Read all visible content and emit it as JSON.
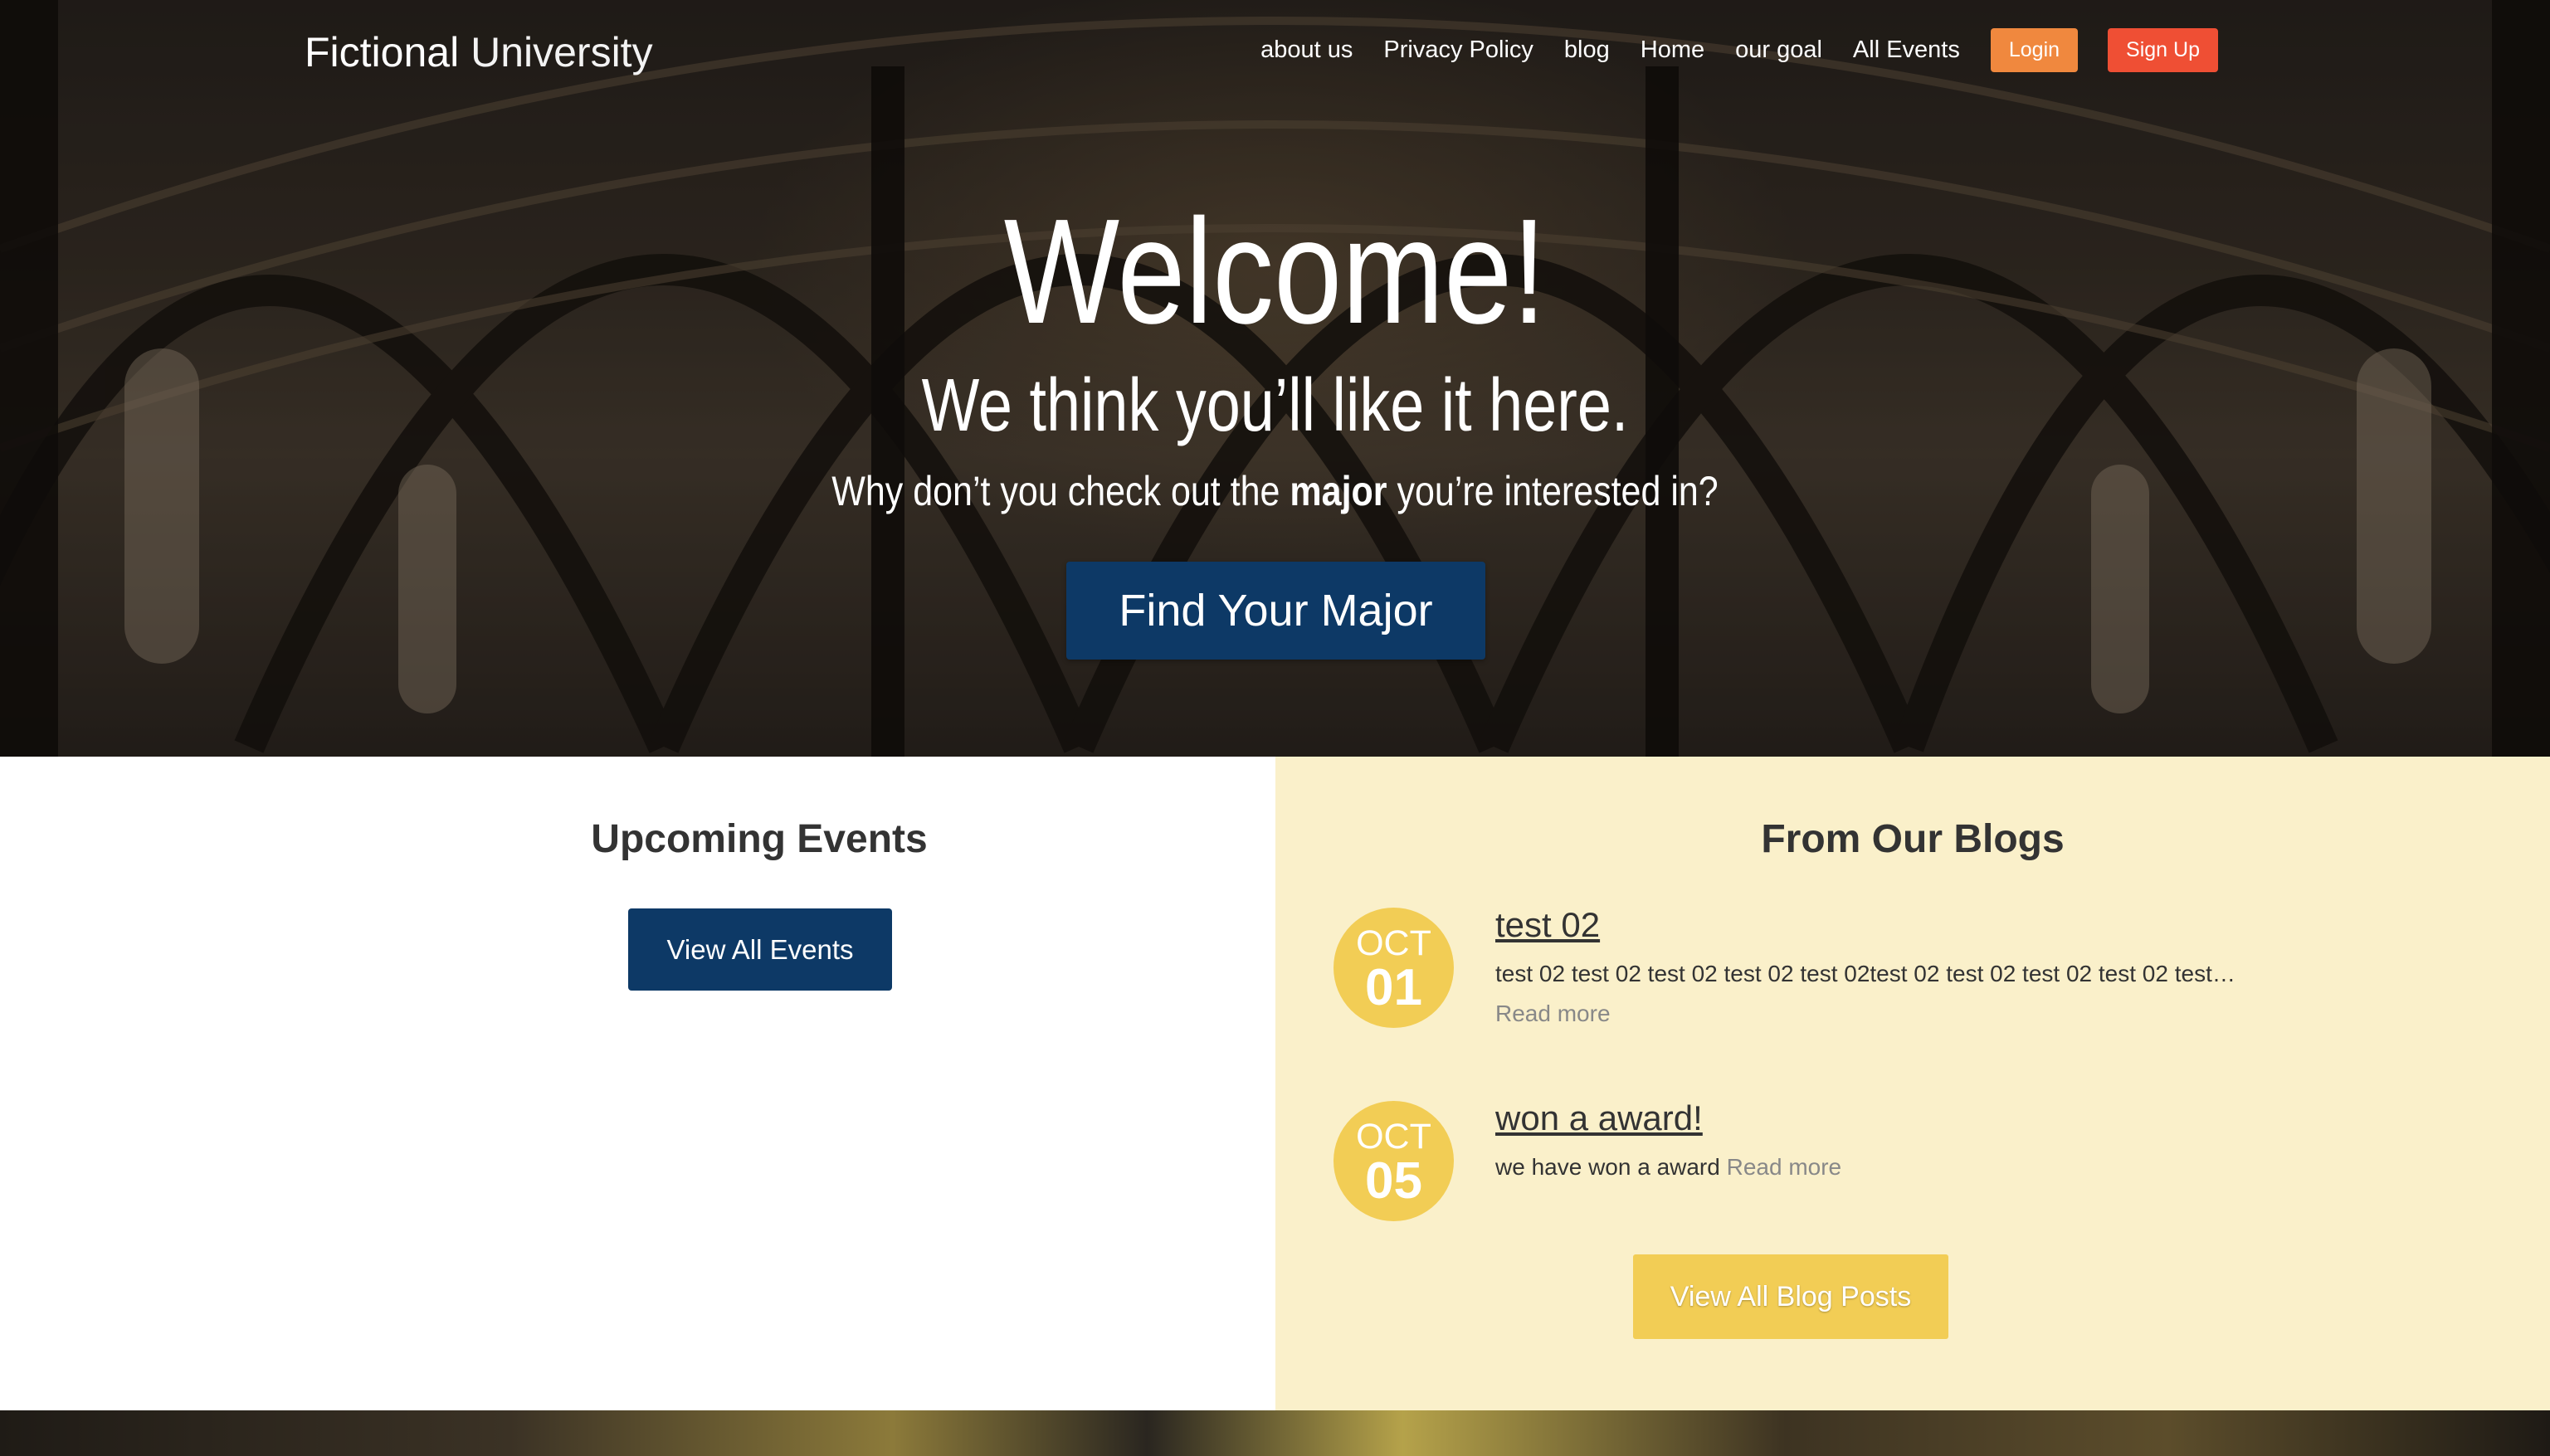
{
  "header": {
    "logo_bold": "Fictional",
    "logo_light": "University",
    "nav": [
      "about us",
      "Privacy Policy",
      "blog",
      "Home",
      "our goal",
      "All Events"
    ],
    "login_label": "Login",
    "signup_label": "Sign Up"
  },
  "hero": {
    "title": "Welcome!",
    "subtitle": "We think you’ll like it here.",
    "desc_before": "Why don’t you check out the ",
    "desc_bold": "major",
    "desc_after": " you’re interested in?",
    "cta_label": "Find Your Major"
  },
  "events": {
    "title": "Upcoming Events",
    "button_label": "View All Events"
  },
  "blogs": {
    "title": "From Our Blogs",
    "posts": [
      {
        "month": "OCT",
        "day": "01",
        "title": "test 02",
        "excerpt": "test 02 test 02 test 02 test 02 test 02test 02 test 02 test 02 test 02 test…",
        "read_more": "Read more"
      },
      {
        "month": "OCT",
        "day": "05",
        "title": "won a award!",
        "excerpt": "we have won a award",
        "read_more": "Read more"
      }
    ],
    "button_label": "View All Blog Posts"
  },
  "colors": {
    "primary_blue": "#0d3966",
    "login_orange": "#f0883e",
    "signup_red": "#ef4f34",
    "beige": "#faf0ca",
    "yellow": "#f2cd55"
  }
}
